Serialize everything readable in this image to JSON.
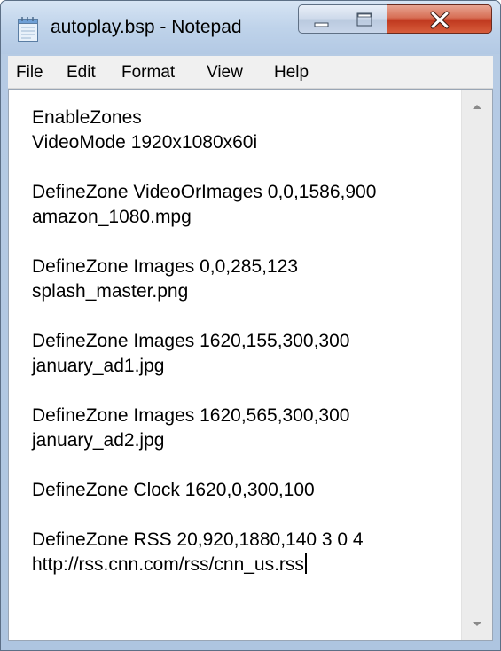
{
  "window": {
    "title": "autoplay.bsp - Notepad",
    "icon": "notepad-icon",
    "controls": [
      "minimize-icon",
      "maximize-icon",
      "close-icon"
    ],
    "close_color": "#c7432a",
    "frame_color": "#b9cde6"
  },
  "menu": {
    "items": [
      {
        "label": "File"
      },
      {
        "label": "Edit"
      },
      {
        "label": "Format"
      },
      {
        "label": "View"
      },
      {
        "label": "Help"
      }
    ]
  },
  "editor": {
    "lines": [
      "EnableZones",
      "VideoMode 1920x1080x60i",
      "",
      "DefineZone VideoOrImages 0,0,1586,900",
      "amazon_1080.mpg",
      "",
      "DefineZone Images 0,0,285,123",
      "splash_master.png",
      "",
      "DefineZone Images 1620,155,300,300",
      "january_ad1.jpg",
      "",
      "DefineZone Images 1620,565,300,300",
      "january_ad2.jpg",
      "",
      "DefineZone Clock 1620,0,300,100",
      "",
      "DefineZone RSS 20,920,1880,140 3 0 4",
      "http://rss.cnn.com/rss/cnn_us.rss"
    ],
    "scrollbar": {
      "up_icon": "scroll-up-arrow-icon",
      "down_icon": "scroll-down-arrow-icon"
    }
  }
}
